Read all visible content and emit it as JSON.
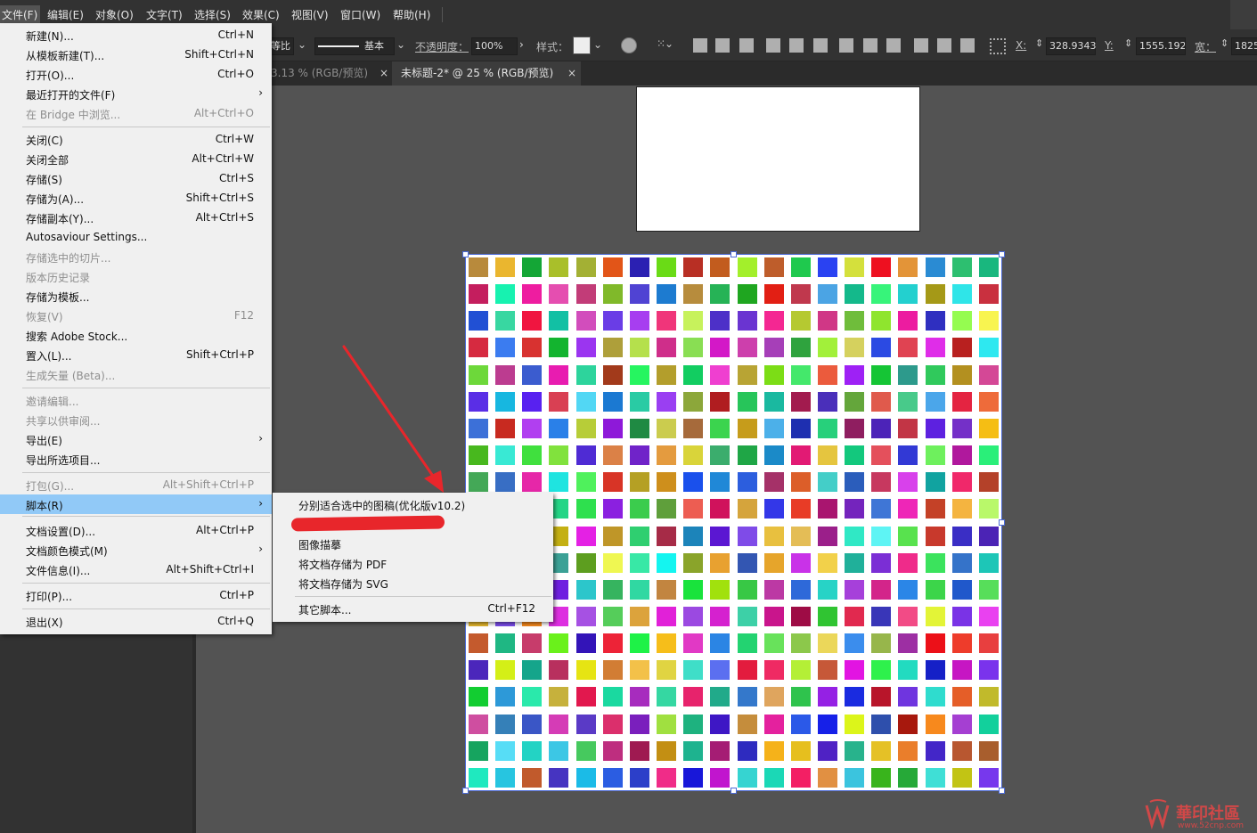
{
  "menubar": {
    "items": [
      "文件(F)",
      "编辑(E)",
      "对象(O)",
      "文字(T)",
      "选择(S)",
      "效果(C)",
      "视图(V)",
      "窗口(W)",
      "帮助(H)"
    ]
  },
  "toolbar": {
    "ratio_label": "等比",
    "stroke_label": "基本",
    "opacity_label": "不透明度：",
    "opacity_value": "100%",
    "style_label": "样式：",
    "x_label": "X:",
    "x_value": "328.9343",
    "y_label": "Y:",
    "y_value": "1555.1923",
    "w_label": "宽：",
    "w_value": "1825"
  },
  "tabs": [
    {
      "label": "3.13 % (RGB/预览)",
      "close": "×"
    },
    {
      "label": "未标题-2* @ 25 % (RGB/预览)",
      "close": "×"
    }
  ],
  "file_menu": {
    "items": [
      {
        "label": "新建(N)...",
        "shortcut": "Ctrl+N"
      },
      {
        "label": "从模板新建(T)...",
        "shortcut": "Shift+Ctrl+N"
      },
      {
        "label": "打开(O)...",
        "shortcut": "Ctrl+O"
      },
      {
        "label": "最近打开的文件(F)",
        "shortcut": "›"
      },
      {
        "label": "在 Bridge 中浏览...",
        "shortcut": "Alt+Ctrl+O"
      },
      {
        "label": "关闭(C)",
        "shortcut": "Ctrl+W"
      },
      {
        "label": "关闭全部",
        "shortcut": "Alt+Ctrl+W"
      },
      {
        "label": "存储(S)",
        "shortcut": "Ctrl+S"
      },
      {
        "label": "存储为(A)...",
        "shortcut": "Shift+Ctrl+S"
      },
      {
        "label": "存储副本(Y)...",
        "shortcut": "Alt+Ctrl+S"
      },
      {
        "label": "Autosaviour Settings...",
        "shortcut": ""
      },
      {
        "label": "存储选中的切片...",
        "shortcut": ""
      },
      {
        "label": "版本历史记录",
        "shortcut": ""
      },
      {
        "label": "存储为模板...",
        "shortcut": ""
      },
      {
        "label": "恢复(V)",
        "shortcut": "F12"
      },
      {
        "label": "搜索 Adobe Stock...",
        "shortcut": ""
      },
      {
        "label": "置入(L)...",
        "shortcut": "Shift+Ctrl+P"
      },
      {
        "label": "生成矢量 (Beta)...",
        "shortcut": ""
      },
      {
        "label": "邀请编辑...",
        "shortcut": ""
      },
      {
        "label": "共享以供审阅...",
        "shortcut": ""
      },
      {
        "label": "导出(E)",
        "shortcut": "›"
      },
      {
        "label": "导出所选项目...",
        "shortcut": ""
      },
      {
        "label": "打包(G)...",
        "shortcut": "Alt+Shift+Ctrl+P"
      },
      {
        "label": "脚本(R)",
        "shortcut": "›"
      },
      {
        "label": "文档设置(D)...",
        "shortcut": "Alt+Ctrl+P"
      },
      {
        "label": "文档颜色模式(M)",
        "shortcut": "›"
      },
      {
        "label": "文件信息(I)...",
        "shortcut": "Alt+Shift+Ctrl+I"
      },
      {
        "label": "打印(P)...",
        "shortcut": "Ctrl+P"
      },
      {
        "label": "退出(X)",
        "shortcut": "Ctrl+Q"
      }
    ]
  },
  "script_submenu": {
    "items": [
      {
        "label": "分别适合选中的图稿(优化版v10.2)",
        "shortcut": ""
      },
      {
        "label": "图像描摹",
        "shortcut": ""
      },
      {
        "label": "将文档存储为 PDF",
        "shortcut": ""
      },
      {
        "label": "将文档存储为 SVG",
        "shortcut": ""
      },
      {
        "label": "其它脚本...",
        "shortcut": "Ctrl+F12"
      }
    ]
  },
  "swatch_grid": {
    "rows": 20,
    "cols": 20,
    "colors": [
      "#b88a3c",
      "#eab62f",
      "#14a636",
      "#a9bf2a",
      "#a3b034",
      "#e25518",
      "#2b20b2",
      "#6adb16",
      "#b82f24",
      "#c25c1e",
      "#a3ef2b",
      "#be5d2b",
      "#1fc94e",
      "#2a42f2",
      "#d4e03c",
      "#ee1020",
      "#e39438",
      "#2a8bd3",
      "#2dbf70",
      "#19b77e",
      "#c41e5e",
      "#17f2b0",
      "#ee1da0",
      "#e54eb0",
      "#c23c78",
      "#80b92a",
      "#5043d3",
      "#1d7bd0",
      "#b78c3d",
      "#26b356",
      "#1fa620",
      "#e21f14",
      "#c0384d",
      "#4ba4e4",
      "#14b98b",
      "#37f47a",
      "#23d0cf",
      "#a59917",
      "#2fe5e8",
      "#c9303f",
      "#2150d4",
      "#38d7a1",
      "#f01540",
      "#12c0a4",
      "#d24dbc",
      "#6a3de6",
      "#a73ef0",
      "#f0357a",
      "#c7f25c",
      "#4d30c8",
      "#6a34d1",
      "#f42792",
      "#b5c931",
      "#d03786",
      "#6fbd3b",
      "#8fe52e",
      "#ec1ca0",
      "#2f2fc0",
      "#95fc50",
      "#f8f450",
      "#d62a40",
      "#3b7cf0",
      "#d83230",
      "#13b42f",
      "#9b35f0",
      "#ae9f3a",
      "#b5e04c",
      "#cf2e8a",
      "#89de53",
      "#d318c7",
      "#cd3fac",
      "#a63fb8",
      "#2fa33e",
      "#a2f03a",
      "#d5d15e",
      "#2b4ae3",
      "#e04352",
      "#df2de8",
      "#b8201f",
      "#2ee8f0",
      "#6dd83a",
      "#bc3c90",
      "#3b5ccf",
      "#e81cb0",
      "#2dd49c",
      "#a23a1b",
      "#26f560",
      "#b39e2c",
      "#12cd61",
      "#ef3fd0",
      "#b8a434",
      "#7cdd16",
      "#44e86b",
      "#eb5b3d",
      "#9e21f5",
      "#15c535",
      "#2d9a8c",
      "#30c95c",
      "#b39020",
      "#d44896",
      "#5a2ee6",
      "#17b7e0",
      "#5821f0",
      "#d94053",
      "#52d7f4",
      "#1b79d2",
      "#29cba4",
      "#9a3ff2",
      "#8ca73a",
      "#b01d20",
      "#27c55a",
      "#1ab9a0",
      "#a21b4e",
      "#4a2fba",
      "#64a63b",
      "#e05a4c",
      "#48ca8a",
      "#4ba6ea",
      "#e42441",
      "#ee6b3a",
      "#3c70d8",
      "#c82a20",
      "#b13ff0",
      "#2a80e8",
      "#b7cd38",
      "#8e19d9",
      "#1f8a43",
      "#cbcc4e",
      "#a66a3b",
      "#3bd44e",
      "#c69c1b",
      "#4cb0e9",
      "#1e2fb0",
      "#27d07b",
      "#8f1e60",
      "#4c23b8",
      "#c23545",
      "#5d21e0",
      "#7430c8",
      "#f5be14",
      "#48b81e",
      "#39e9d4",
      "#40e03e",
      "#81e23d",
      "#4f2bd4",
      "#db8147",
      "#7023c9",
      "#e49b3f",
      "#d9d43a",
      "#3bad6d",
      "#1fa646",
      "#1b8ac8",
      "#e21a74",
      "#e5c53f",
      "#13c87d",
      "#e4505c",
      "#3239d5",
      "#6ef05d",
      "#b0189d",
      "#2aef79",
      "#44a857",
      "#386ec4",
      "#e627a8",
      "#1fe4e0",
      "#4ff15c",
      "#d83426",
      "#b5a024",
      "#ce8f1c",
      "#1a50ec",
      "#2088d7",
      "#2c5ede",
      "#a53168",
      "#dc5e29",
      "#44cec8",
      "#2b5dbb",
      "#c7385f",
      "#d841eb",
      "#11a3a0",
      "#f0286a",
      "#b44129",
      "#e93e35",
      "#0b8cd6",
      "#0ad6e8",
      "#24d586",
      "#2ee04e",
      "#8b20e0",
      "#3bcc4d",
      "#5f9f3b",
      "#ed5d52",
      "#d0125c",
      "#d5a43c",
      "#3337e8",
      "#e83c26",
      "#a9156f",
      "#7424bd",
      "#3f76d6",
      "#ee26b7",
      "#c44127",
      "#f4b440",
      "#b9f86a",
      "#48ea3a",
      "#17e9ee",
      "#b0344c",
      "#c4b013",
      "#e421e4",
      "#bf9628",
      "#2fcf70",
      "#a62b47",
      "#1c84ba",
      "#5b17d2",
      "#7f4be8",
      "#e8c03f",
      "#e4bd56",
      "#9b1f8a",
      "#30e8c5",
      "#5ef4f4",
      "#58e24e",
      "#c8392c",
      "#3a2ec5",
      "#4b23b5",
      "#c3351d",
      "#1d8bb5",
      "#e9148c",
      "#3ba196",
      "#5d9e1f",
      "#eff752",
      "#38e8a6",
      "#14f5f0",
      "#8aa42a",
      "#e8a130",
      "#3356b2",
      "#e6a52b",
      "#c932e8",
      "#f2d14a",
      "#20b09a",
      "#7b2ed5",
      "#ef2b8a",
      "#3be35d",
      "#3573c9",
      "#1dc6b7",
      "#e5b61b",
      "#31e393",
      "#9ba638",
      "#6f1fe0",
      "#2cc6cb",
      "#36b45f",
      "#30d8a2",
      "#c28540",
      "#19e33c",
      "#a1e10d",
      "#38c845",
      "#bc39a4",
      "#2e69d9",
      "#27d3c6",
      "#a640da",
      "#d3258a",
      "#2b86e7",
      "#3cd54a",
      "#2058cb",
      "#57de5a",
      "#e5b62d",
      "#7b4ded",
      "#f7891d",
      "#dd2fe0",
      "#a651e3",
      "#55cd5a",
      "#dca33c",
      "#e121d8",
      "#9b49e1",
      "#d521cf",
      "#3dd0a7",
      "#c9158c",
      "#9e0c45",
      "#30c432",
      "#e1294f",
      "#3936b8",
      "#f24b86",
      "#e3f437",
      "#7a33e6",
      "#e941f0",
      "#c45a2d",
      "#1fb783",
      "#c73c6b",
      "#6af11b",
      "#3314b8",
      "#ed2337",
      "#1ef247",
      "#f6be1a",
      "#e139c5",
      "#2b85e4",
      "#23d371",
      "#68e25b",
      "#8cc84b",
      "#ebd75a",
      "#3b8ded",
      "#97b64b",
      "#9d2fa3",
      "#ec1018",
      "#ee3c2b",
      "#e83f3f",
      "#4b26bb",
      "#d4ef17",
      "#15a58b",
      "#b8305e",
      "#e6e413",
      "#d27d34",
      "#f3c149",
      "#e0d442",
      "#3fdec8",
      "#5b6ff0",
      "#e31c3e",
      "#ef2a63",
      "#b4ef36",
      "#c65838",
      "#e214e2",
      "#2ef14c",
      "#22dbc0",
      "#1520c7",
      "#c616c3",
      "#7a33ec",
      "#12cd31",
      "#2d99d8",
      "#2ae9ab",
      "#c6b13c",
      "#e2184e",
      "#1ad9a0",
      "#a72cbe",
      "#35d7a2",
      "#e7236c",
      "#21aa8a",
      "#3478cb",
      "#dfa55e",
      "#2fc34d",
      "#9521e4",
      "#1a2be0",
      "#b8152a",
      "#6f35df",
      "#2fdcce",
      "#e55e28",
      "#c1ba2b",
      "#cf4ea0",
      "#3580b8",
      "#3a56c6",
      "#d53cb6",
      "#5a3ac6",
      "#db2f6c",
      "#7a1fbd",
      "#a0e040",
      "#1eb27f",
      "#3e17c5",
      "#c58d3c",
      "#e4219e",
      "#2b59e8",
      "#1620e8",
      "#dcf51a",
      "#2e4fac",
      "#a7180d",
      "#f7891d",
      "#a53fd2",
      "#12d09c",
      "#16a45f",
      "#57ddf6",
      "#23d3c4",
      "#3cc7e5",
      "#46c95e",
      "#be2e7f",
      "#9f1a51",
      "#c38f13",
      "#1eb38f",
      "#a51d74",
      "#2e2bbf",
      "#f5b21a",
      "#e6bf1e",
      "#4f22c4",
      "#28b38c",
      "#e5c126",
      "#ea7e2b",
      "#4326c8",
      "#b85730",
      "#a85e2d",
      "#1fe9bf",
      "#27c5e0",
      "#c15a2c",
      "#4634c1",
      "#1bbbe7",
      "#2b5de2",
      "#2c3fc9",
      "#f02c88",
      "#1817d9",
      "#c115ce",
      "#36d4d1",
      "#1bd8b6",
      "#f31f64",
      "#e19042",
      "#3bc4de",
      "#39b41c",
      "#26a938",
      "#3fdfd6",
      "#c2c414",
      "#7738ed"
    ]
  },
  "watermark": {
    "text": "華印社區",
    "url": "www.52cnp.com"
  }
}
